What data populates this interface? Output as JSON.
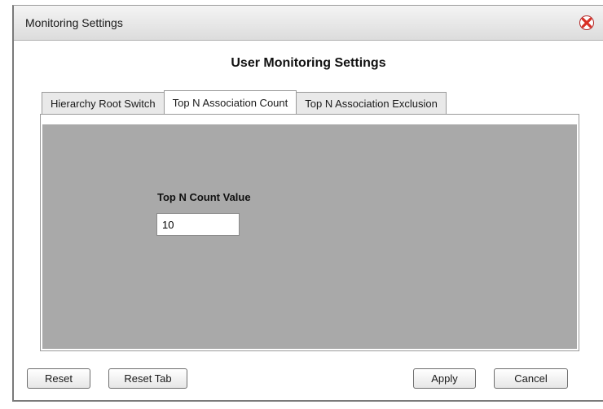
{
  "dialog": {
    "title": "Monitoring Settings",
    "close_icon": "close-icon",
    "heading": "User Monitoring Settings"
  },
  "tabs": [
    {
      "label": "Hierarchy Root Switch",
      "active": false
    },
    {
      "label": "Top N Association Count",
      "active": true
    },
    {
      "label": "Top N Association Exclusion",
      "active": false
    }
  ],
  "form": {
    "top_n_label": "Top N Count Value",
    "top_n_value": "10"
  },
  "buttons": {
    "reset": "Reset",
    "reset_tab": "Reset Tab",
    "apply": "Apply",
    "cancel": "Cancel"
  },
  "colors": {
    "panel_background": "#a9a9a9",
    "close_icon": "#d93025"
  }
}
